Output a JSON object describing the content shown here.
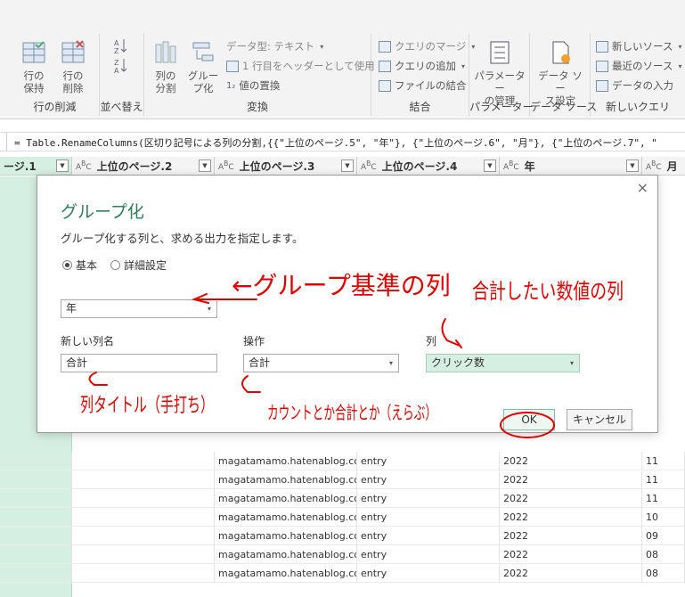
{
  "ribbon": {
    "keep_rows": "行の\n保持",
    "remove_rows": "行の\n削除",
    "reduce_rows_label": "行の削減",
    "sort_label": "並べ替え",
    "split_column": "列の\n分割",
    "group_by": "グルー\nプ化",
    "data_type": "データ型: テキスト",
    "first_row_header": "1 行目をヘッダーとして使用",
    "replace_values": "値の置換",
    "transform_label": "変換",
    "merge_queries": "クエリのマージ",
    "append_queries": "クエリの追加",
    "combine_files": "ファイルの結合",
    "combine_label": "結合",
    "manage_parameters": "パラメーター\nの管理",
    "parameters_label": "パラメーター",
    "data_source_settings": "データ ソー\nス設定",
    "data_sources_label": "データ ソース",
    "new_source": "新しいソース",
    "recent_sources": "最近のソース",
    "enter_data": "データの入力",
    "new_query_label": "新しいクエリ"
  },
  "formula_bar": {
    "text": "= Table.RenameColumns(区切り記号による列の分割,{{\"上位のページ.5\", \"年\"}, {\"上位のページ.6\", \"月\"}, {\"上位のページ.7\", \""
  },
  "grid": {
    "columns": [
      "ージ.1",
      "上位のページ.2",
      "上位のページ.3",
      "上位のページ.4",
      "年",
      "月"
    ],
    "rows": [
      [
        "",
        "",
        "magatamamo.hatenablog.com",
        "entry",
        "2022",
        "11"
      ],
      [
        "",
        "",
        "magatamamo.hatenablog.com",
        "entry",
        "2022",
        "11"
      ],
      [
        "",
        "",
        "magatamamo.hatenablog.com",
        "entry",
        "2022",
        "11"
      ],
      [
        "",
        "",
        "magatamamo.hatenablog.com",
        "entry",
        "2022",
        "10"
      ],
      [
        "",
        "",
        "magatamamo.hatenablog.com",
        "entry",
        "2022",
        "09"
      ],
      [
        "",
        "",
        "magatamamo.hatenablog.com",
        "entry",
        "2022",
        "08"
      ],
      [
        "",
        "",
        "magatamamo.hatenablog.com",
        "entry",
        "2022",
        "08"
      ]
    ]
  },
  "dialog": {
    "title": "グループ化",
    "description": "グループ化する列と、求める出力を指定します。",
    "radio_basic": "基本",
    "radio_advanced": "詳細設定",
    "group_column_value": "年",
    "new_column_label": "新しい列名",
    "new_column_value": "合計",
    "operation_label": "操作",
    "operation_value": "合計",
    "column_label": "列",
    "column_value": "クリック数",
    "ok_label": "OK",
    "cancel_label": "キャンセル",
    "close_icon": "×"
  },
  "annotations": {
    "group_basis": "←グループ基準の列",
    "sum_target": "合計したい数値の列",
    "column_title": "列タイトル（手打ち）",
    "count_or_sum": "カウントとか合計とか（えらぶ）"
  },
  "colors": {
    "accent": "#2f7d5a",
    "selected_column": "#d5efe2",
    "annotation_red": "#e00000"
  }
}
